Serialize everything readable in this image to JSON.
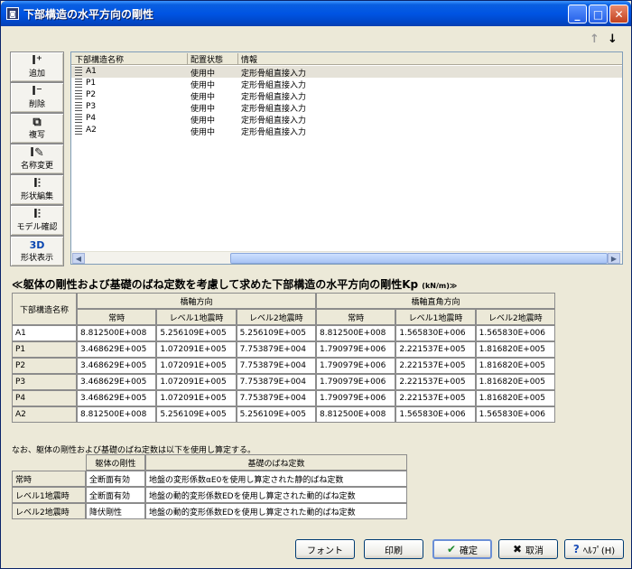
{
  "window": {
    "title": "下部構造の水平方向の剛性",
    "app_icon": "app-icon",
    "controls": [
      {
        "name": "minimize-button",
        "label": "_"
      },
      {
        "name": "maximize-button",
        "label": "□"
      },
      {
        "name": "close-button",
        "label": "✕"
      }
    ]
  },
  "sort_arrows": {
    "up": "↑",
    "down": "↓"
  },
  "sidebar": {
    "items": [
      {
        "name": "add-button",
        "icon": "add-icon",
        "glyph": "I⁺",
        "label": "追加"
      },
      {
        "name": "delete-button",
        "icon": "delete-icon",
        "glyph": "I⁻",
        "label": "削除"
      },
      {
        "name": "copy-button",
        "icon": "copy-icon",
        "glyph": "⧉",
        "label": "複写"
      },
      {
        "name": "rename-button",
        "icon": "rename-icon",
        "glyph": "I✎",
        "label": "名称変更"
      },
      {
        "name": "shape-edit-button",
        "icon": "shape-edit-icon",
        "glyph": "I⫶",
        "label": "形状編集"
      },
      {
        "name": "model-check-button",
        "icon": "model-check-icon",
        "glyph": "I⫶",
        "label": "モデル確認"
      },
      {
        "name": "shape-display-button",
        "icon": "3d-icon",
        "glyph": "3D",
        "label": "形状表示"
      }
    ]
  },
  "list": {
    "headers": [
      "下部構造名称",
      "配置状態",
      "情報"
    ],
    "rows": [
      {
        "name": "A1",
        "status": "使用中",
        "info": "定形骨組直接入力",
        "selected": true
      },
      {
        "name": "P1",
        "status": "使用中",
        "info": "定形骨組直接入力"
      },
      {
        "name": "P2",
        "status": "使用中",
        "info": "定形骨組直接入力"
      },
      {
        "name": "P3",
        "status": "使用中",
        "info": "定形骨組直接入力"
      },
      {
        "name": "P4",
        "status": "使用中",
        "info": "定形骨組直接入力"
      },
      {
        "name": "A2",
        "status": "使用中",
        "info": "定形骨組直接入力"
      }
    ]
  },
  "results": {
    "title": "≪躯体の剛性および基礎のばね定数を考慮して求めた下部構造の水平方向の剛性Kp",
    "unit": "(kN/m)≫",
    "col_label": "下部構造名称",
    "group1": "橋軸方向",
    "group2": "橋軸直角方向",
    "sub_headers": [
      "常時",
      "レベル1地震時",
      "レベル2地震時",
      "常時",
      "レベル1地震時",
      "レベル2地震時"
    ],
    "rows": [
      {
        "label": "A1",
        "values": [
          "8.812500E+008",
          "5.256109E+005",
          "5.256109E+005",
          "8.812500E+008",
          "1.565830E+006",
          "1.565830E+006"
        ]
      },
      {
        "label": "P1",
        "values": [
          "3.468629E+005",
          "1.072091E+005",
          "7.753879E+004",
          "1.790979E+006",
          "2.221537E+005",
          "1.816820E+005"
        ]
      },
      {
        "label": "P2",
        "values": [
          "3.468629E+005",
          "1.072091E+005",
          "7.753879E+004",
          "1.790979E+006",
          "2.221537E+005",
          "1.816820E+005"
        ]
      },
      {
        "label": "P3",
        "values": [
          "3.468629E+005",
          "1.072091E+005",
          "7.753879E+004",
          "1.790979E+006",
          "2.221537E+005",
          "1.816820E+005"
        ]
      },
      {
        "label": "P4",
        "values": [
          "3.468629E+005",
          "1.072091E+005",
          "7.753879E+004",
          "1.790979E+006",
          "2.221537E+005",
          "1.816820E+005"
        ]
      },
      {
        "label": "A2",
        "values": [
          "8.812500E+008",
          "5.256109E+005",
          "5.256109E+005",
          "8.812500E+008",
          "1.565830E+006",
          "1.565830E+006"
        ]
      }
    ]
  },
  "note": "なお、躯体の剛性および基礎のばね定数は以下を使用し算定する。",
  "legend": {
    "headers": [
      "躯体の剛性",
      "基礎のばね定数"
    ],
    "rows": [
      {
        "label": "常時",
        "stiffness": "全断面有効",
        "spring": "地盤の変形係数αE0を使用し算定された静的ばね定数"
      },
      {
        "label": "レベル1地震時",
        "stiffness": "全断面有効",
        "spring": "地盤の動的変形係数EDを使用し算定された動的ばね定数"
      },
      {
        "label": "レベル2地震時",
        "stiffness": "降伏剛性",
        "spring": "地盤の動的変形係数EDを使用し算定された動的ばね定数"
      }
    ]
  },
  "buttons": {
    "font": "フォント",
    "print": "印刷",
    "ok": "確定",
    "cancel": "取消",
    "help": "ﾍﾙﾌﾟ(H)"
  }
}
